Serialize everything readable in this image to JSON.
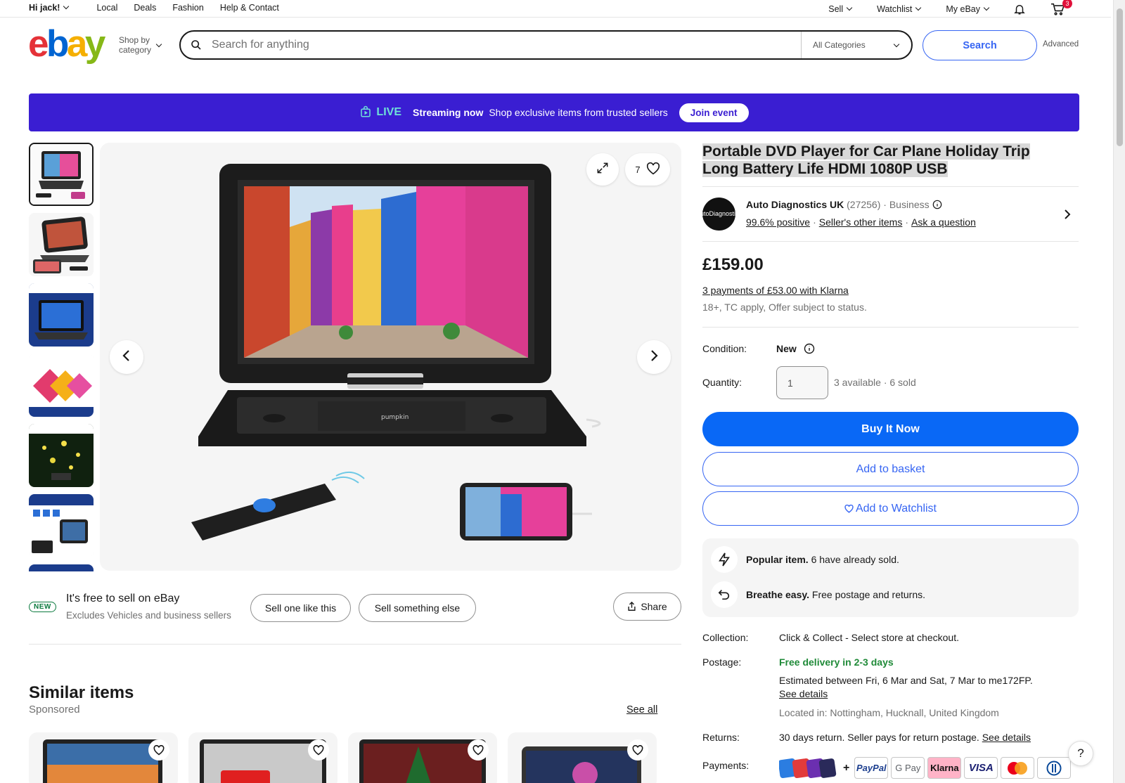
{
  "topbar": {
    "greeting": "Hi jack!",
    "left_links": [
      "Local",
      "Deals",
      "Fashion",
      "Help & Contact"
    ],
    "right_links": [
      "Sell",
      "Watchlist",
      "My eBay"
    ],
    "cart_count": "3"
  },
  "header": {
    "logo": {
      "e": "e",
      "b": "b",
      "a": "a",
      "y": "y"
    },
    "shop_by_line1": "Shop by",
    "shop_by_line2": "category",
    "search_placeholder": "Search for anything",
    "category_selected": "All Categories",
    "search_button": "Search",
    "advanced": "Advanced"
  },
  "banner": {
    "live": "LIVE",
    "streaming": "Streaming now",
    "text": "Shop exclusive items from trusted sellers",
    "button": "Join event"
  },
  "gallery": {
    "favorite_count": "7"
  },
  "sell_row": {
    "new_tag": "NEW",
    "headline": "It's free to sell on eBay",
    "subtext": "Excludes Vehicles and business sellers",
    "sell_one": "Sell one like this",
    "sell_else": "Sell something else",
    "share": "Share"
  },
  "similar": {
    "title": "Similar items",
    "sponsored": "Sponsored",
    "see_all": "See all"
  },
  "item": {
    "title": "Portable DVD Player for Car Plane Holiday Trip Long Battery Life HDMI 1080P USB",
    "seller_logo_text": "AutoDiagnostics",
    "seller_name": "Auto Diagnostics UK",
    "seller_feedback": "(27256)",
    "seller_type": "Business",
    "positive": "99.6% positive",
    "other_items": "Seller's other items",
    "ask": "Ask a question",
    "price": "£159.00",
    "klarna": "3 payments of £53.00 with Klarna",
    "klarna_note": "18+, TC apply, Offer subject to status.",
    "condition_label": "Condition:",
    "condition_value": "New",
    "quantity_label": "Quantity:",
    "quantity_value": "1",
    "availability": "3 available · 6 sold",
    "buy_now": "Buy It Now",
    "add_basket": "Add to basket",
    "add_watchlist": "Add to Watchlist",
    "popular_bold": "Popular item.",
    "popular_text": "6 have already sold.",
    "breathe_bold": "Breathe easy.",
    "breathe_text": "Free postage and returns.",
    "collection_label": "Collection:",
    "collection_value": "Click & Collect - Select store at checkout.",
    "postage_label": "Postage:",
    "postage_free": "Free delivery in 2-3 days",
    "postage_estimate": "Estimated between Fri, 6 Mar and Sat, 7 Mar to me172FP.",
    "see_details": "See details",
    "located": "Located in: Nottingham, Hucknall, United Kingdom",
    "returns_label": "Returns:",
    "returns_value": "30 days return. Seller pays for return postage.",
    "returns_details": "See details",
    "payments_label": "Payments:",
    "pay_plus": "+",
    "pay_paypal": "PayPal",
    "pay_gpay": "G Pay",
    "pay_klarna": "Klarna",
    "pay_visa": "VISA"
  },
  "help": "?",
  "colors": {
    "brand_blue": "#3665f3",
    "banner_purple": "#3a1ed2",
    "live_teal": "#6ee0d8",
    "success_green": "#1f8a38"
  }
}
